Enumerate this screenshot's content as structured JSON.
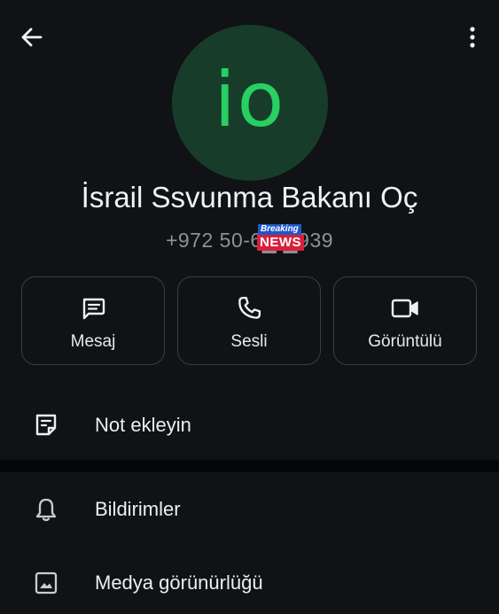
{
  "header": {
    "back_icon": "arrow-left-icon",
    "more_icon": "more-vertical-icon"
  },
  "contact": {
    "avatar_initials": "io",
    "avatar_bg": "#173d2a",
    "avatar_fg": "#28cf62",
    "name": "İsrail Ssvunma Bakanı Oç",
    "phone": "+972 50-6█ █939"
  },
  "watermark": {
    "line1": "Breaking",
    "line2": "NEWS"
  },
  "actions": [
    {
      "label": "Mesaj",
      "icon": "message-icon"
    },
    {
      "label": "Sesli",
      "icon": "phone-icon"
    },
    {
      "label": "Görüntülü",
      "icon": "video-icon"
    }
  ],
  "menu": {
    "note": {
      "label": "Not ekleyin",
      "icon": "note-icon"
    },
    "notifications": {
      "label": "Bildirimler",
      "icon": "bell-icon"
    },
    "media": {
      "label": "Medya görünürlüğü",
      "icon": "image-icon"
    }
  }
}
